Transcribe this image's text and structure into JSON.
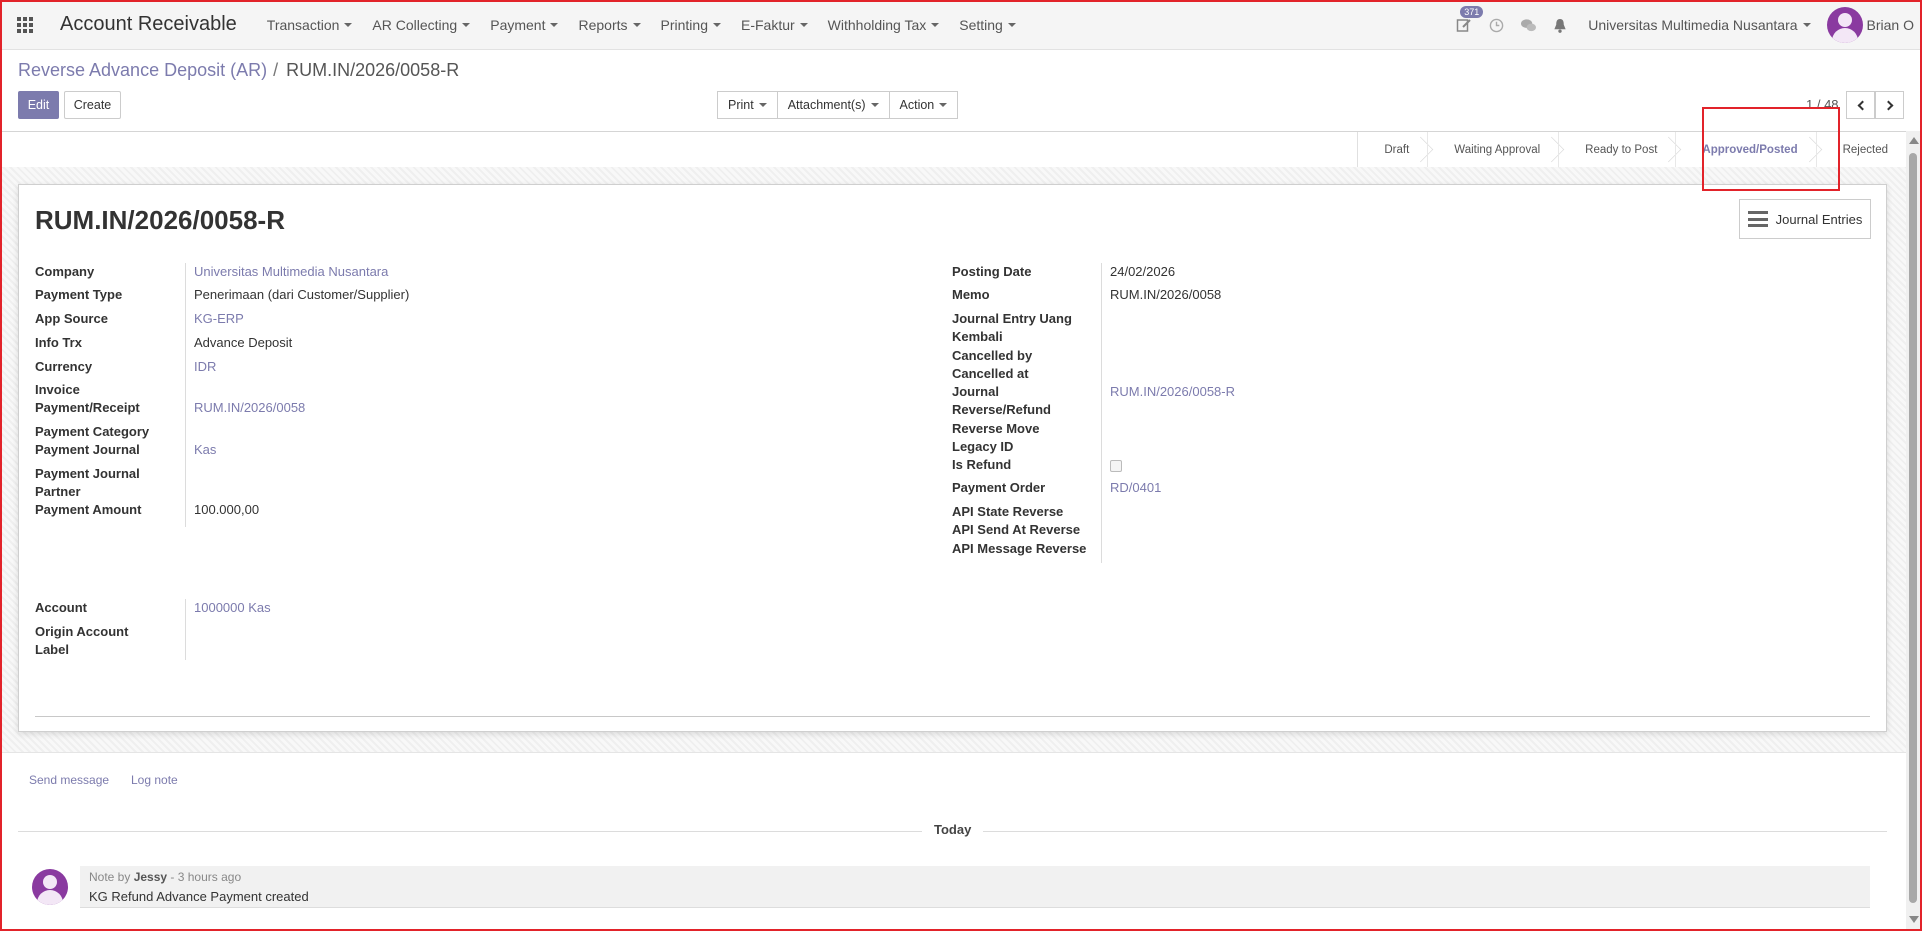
{
  "navbar": {
    "app_title": "Account Receivable",
    "menu": [
      "Transaction",
      "AR Collecting",
      "Payment",
      "Reports",
      "Printing",
      "E-Faktur",
      "Withholding Tax",
      "Setting"
    ],
    "activity_count": "371",
    "company": "Universitas Multimedia Nusantara",
    "user": "Brian O"
  },
  "breadcrumb": {
    "parent": "Reverse Advance Deposit (AR)",
    "separator": "/",
    "current": "RUM.IN/2026/0058-R"
  },
  "buttons": {
    "edit": "Edit",
    "create": "Create",
    "print": "Print",
    "attachments": "Attachment(s)",
    "action": "Action"
  },
  "pager": {
    "value": "1 / 48"
  },
  "statusbar": {
    "stages": [
      "Draft",
      "Waiting Approval",
      "Ready to Post",
      "Approved/Posted",
      "Rejected"
    ],
    "active": "Approved/Posted"
  },
  "record": {
    "title": "RUM.IN/2026/0058-R",
    "smart_button": "Journal Entries",
    "left_fields": [
      {
        "label": "Company",
        "value": "Universitas Multimedia Nusantara"
      },
      {
        "label": "Payment Type",
        "value": "Penerimaan (dari Customer/Supplier)"
      },
      {
        "label": "App Source",
        "value": "KG-ERP"
      },
      {
        "label": "Info Trx",
        "value": "Advance Deposit"
      },
      {
        "label": "Currency",
        "value": "IDR"
      },
      {
        "label": "Invoice Payment/Receipt",
        "value": "RUM.IN/2026/0058"
      },
      {
        "label": "Payment Category",
        "value": ""
      },
      {
        "label": "Payment Journal",
        "value": "Kas"
      },
      {
        "label": "Payment Journal Partner",
        "value": ""
      },
      {
        "label": "Payment Amount",
        "value": "100.000,00"
      }
    ],
    "right_fields": [
      {
        "label": "Posting Date",
        "value": "24/02/2026"
      },
      {
        "label": "Memo",
        "value": "RUM.IN/2026/0058"
      },
      {
        "label": "Journal Entry Uang Kembali",
        "value": ""
      },
      {
        "label": "Cancelled by",
        "value": ""
      },
      {
        "label": "Cancelled at",
        "value": ""
      },
      {
        "label": "Journal Reverse/Refund",
        "value": "RUM.IN/2026/0058-R"
      },
      {
        "label": "Reverse Move",
        "value": ""
      },
      {
        "label": "Legacy ID",
        "value": ""
      },
      {
        "label": "Is Refund",
        "value": ""
      },
      {
        "label": "Payment Order",
        "value": "RD/0401"
      },
      {
        "label": "API State Reverse",
        "value": ""
      },
      {
        "label": "API Send At Reverse",
        "value": ""
      },
      {
        "label": "API Message Reverse",
        "value": ""
      }
    ],
    "bottom_fields": [
      {
        "label": "Account",
        "value": "1000000 Kas"
      },
      {
        "label": "Origin Account Label",
        "value": ""
      }
    ]
  },
  "chatter": {
    "send_message": "Send message",
    "log_note": "Log note",
    "date_separator": "Today",
    "messages": [
      {
        "prefix": "Note by",
        "author": "Jessy",
        "time": "- 3 hours ago",
        "body": "KG Refund Advance Payment created"
      }
    ]
  }
}
